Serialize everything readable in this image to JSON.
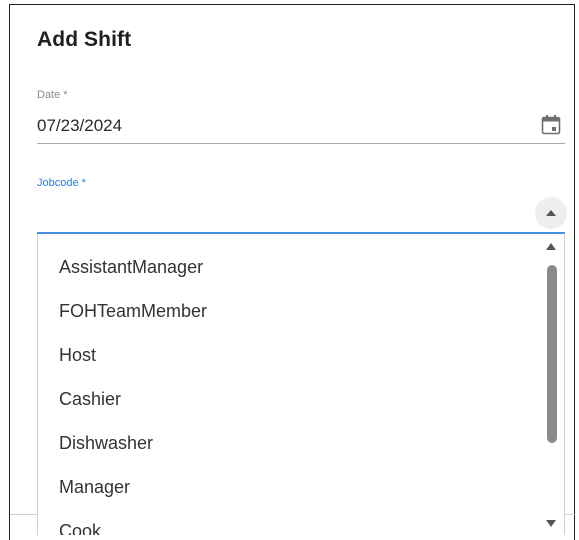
{
  "dialog": {
    "title": "Add Shift"
  },
  "date_field": {
    "label": "Date *",
    "value": "07/23/2024",
    "icon": "calendar-icon"
  },
  "jobcode_field": {
    "label": "Jobcode *",
    "value": "",
    "expanded": true,
    "accent_color": "#2a7de1",
    "options": [
      "AssistantManager",
      "FOHTeamMember",
      "Host",
      "Cashier",
      "Dishwasher",
      "Manager",
      "Cook"
    ]
  }
}
